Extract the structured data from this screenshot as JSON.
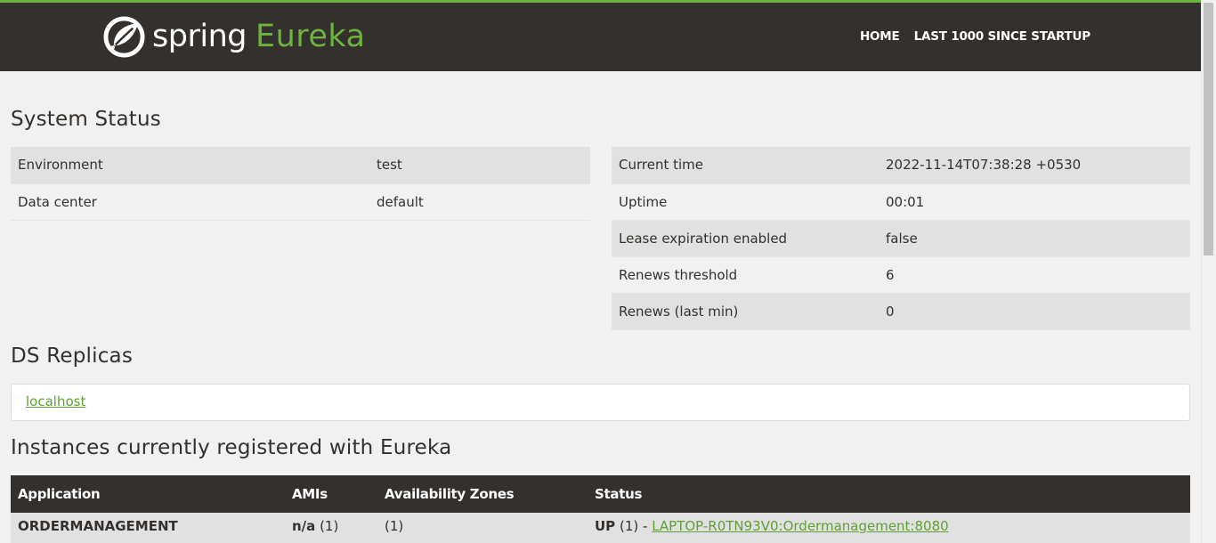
{
  "header": {
    "brand_spring": "spring",
    "brand_eureka": "Eureka",
    "nav": [
      "HOME",
      "LAST 1000 SINCE STARTUP"
    ],
    "accent_color": "#6db33f",
    "bar_color": "#34302d"
  },
  "system_status": {
    "title": "System Status",
    "left": [
      {
        "label": "Environment",
        "value": "test"
      },
      {
        "label": "Data center",
        "value": "default"
      }
    ],
    "right": [
      {
        "label": "Current time",
        "value": "2022-11-14T07:38:28 +0530"
      },
      {
        "label": "Uptime",
        "value": "00:01"
      },
      {
        "label": "Lease expiration enabled",
        "value": "false"
      },
      {
        "label": "Renews threshold",
        "value": "6"
      },
      {
        "label": "Renews (last min)",
        "value": "0"
      }
    ]
  },
  "ds_replicas": {
    "title": "DS Replicas",
    "items": [
      "localhost"
    ]
  },
  "instances": {
    "title": "Instances currently registered with Eureka",
    "headers": [
      "Application",
      "AMIs",
      "Availability Zones",
      "Status"
    ],
    "rows": [
      {
        "application": "ORDERMANAGEMENT",
        "amis": "n/a",
        "amis_count": "(1)",
        "zones": "(1)",
        "status": "UP",
        "status_count": "(1) -",
        "instance_link": "LAPTOP-R0TN93V0:Ordermanagement:8080"
      }
    ]
  }
}
